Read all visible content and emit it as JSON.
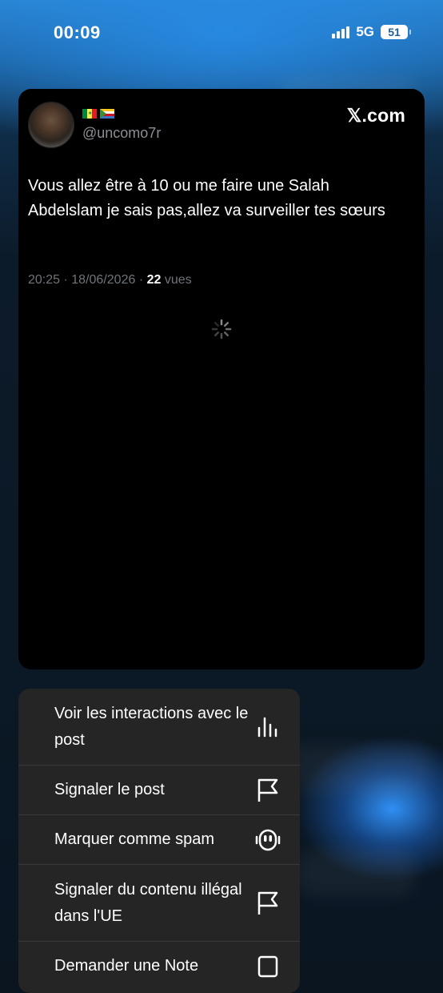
{
  "status_bar": {
    "time": "00:09",
    "network": "5G",
    "battery": "51",
    "signal_bars_filled": 4
  },
  "post": {
    "flags": [
      "senegal-flag-icon",
      "comoros-flag-icon"
    ],
    "handle": "@uncomo7r",
    "source": "𝕏.com",
    "text": "Vous allez être à 10 ou me faire une Salah Abdelslam je sais pas,allez va surveiller tes sœurs",
    "time": "20:25",
    "separator": "·",
    "date": "18/06/2026",
    "views_count": "22",
    "views_label": "vues"
  },
  "menu": {
    "items": [
      {
        "label": "Voir les interactions avec le post",
        "icon": "bar-chart-icon"
      },
      {
        "label": "Signaler le post",
        "icon": "flag-icon"
      },
      {
        "label": "Marquer comme spam",
        "icon": "robot-icon"
      },
      {
        "label": "Signaler du contenu illégal dans l'UE",
        "icon": "flag-icon"
      },
      {
        "label": "Demander une Note",
        "icon": "notes-icon"
      }
    ]
  },
  "colors": {
    "card_bg": "#000000",
    "menu_bg": "#252526",
    "muted_text": "#6f7479",
    "accent_blue": "#1d9bf0"
  }
}
